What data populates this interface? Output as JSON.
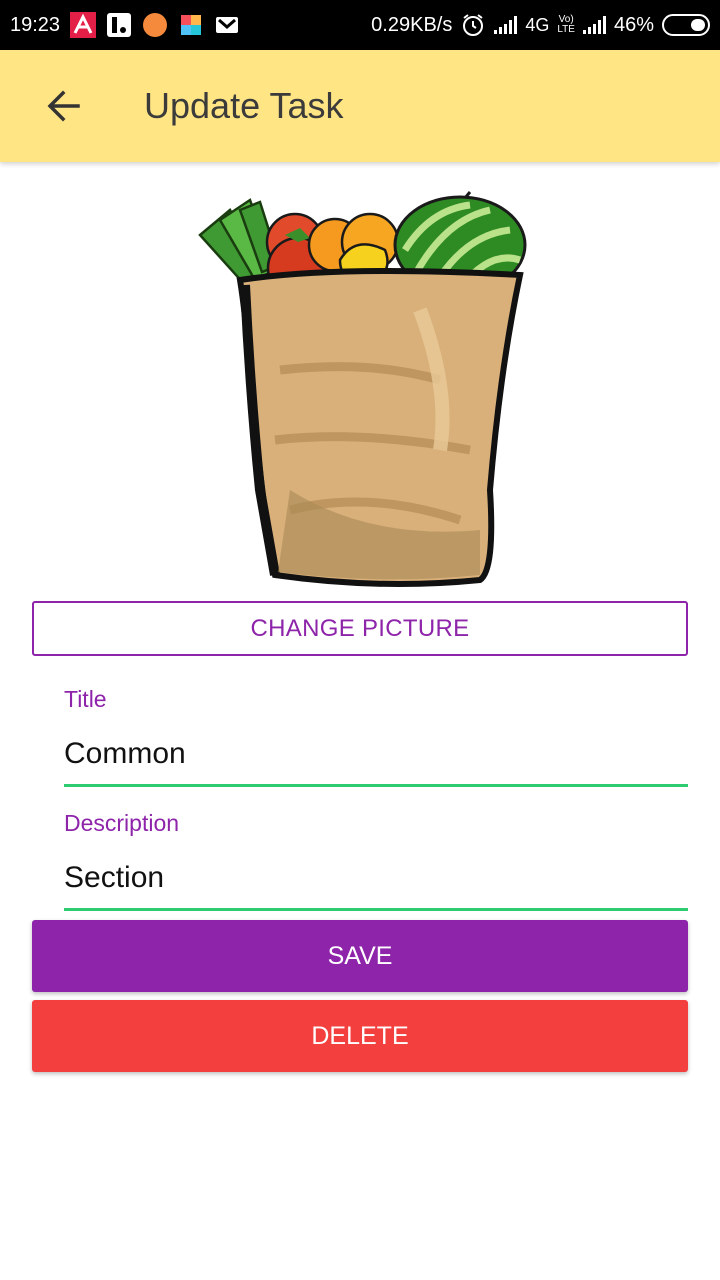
{
  "status_bar": {
    "time": "19:23",
    "speed": "0.29KB/s",
    "network": "4G",
    "volte_top": "Vo)",
    "volte_bottom": "LTE",
    "battery": "46%"
  },
  "app_bar": {
    "title": "Update Task",
    "back_icon": "arrow-left-icon"
  },
  "picture": {
    "description_icon": "grocery-bag-image"
  },
  "change_picture_label": "CHANGE PICTURE",
  "form": {
    "title_label": "Title",
    "title_value": "Common",
    "description_label": "Description",
    "description_value": "Section"
  },
  "actions": {
    "save_label": "SAVE",
    "delete_label": "DELETE"
  },
  "colors": {
    "app_bar": "#ffe584",
    "accent": "#8e24aa",
    "underline": "#2ecc71",
    "delete": "#f43f3f"
  }
}
